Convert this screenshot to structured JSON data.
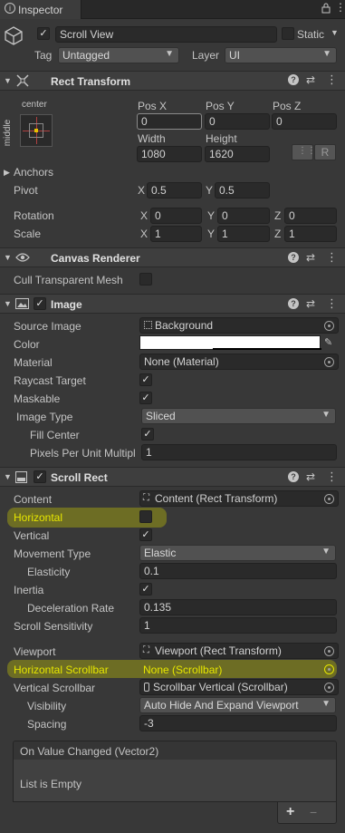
{
  "window": {
    "tab_title": "Inspector"
  },
  "gameobject": {
    "active": true,
    "name": "Scroll View",
    "static_label": "Static",
    "tag_label": "Tag",
    "tag_value": "Untagged",
    "layer_label": "Layer",
    "layer_value": "UI"
  },
  "rect_transform": {
    "title": "Rect Transform",
    "anchor_h": "center",
    "anchor_v": "middle",
    "posx_label": "Pos X",
    "posx": "0",
    "posy_label": "Pos Y",
    "posy": "0",
    "posz_label": "Pos Z",
    "posz": "0",
    "width_label": "Width",
    "width": "1080",
    "height_label": "Height",
    "height": "1620",
    "r_button": "R",
    "anchors_label": "Anchors",
    "pivot_label": "Pivot",
    "pivot_x": "0.5",
    "pivot_y": "0.5",
    "rotation_label": "Rotation",
    "rot_x": "0",
    "rot_y": "0",
    "rot_z": "0",
    "scale_label": "Scale",
    "scale_x": "1",
    "scale_y": "1",
    "scale_z": "1",
    "x": "X",
    "y": "Y",
    "z": "Z"
  },
  "canvas_renderer": {
    "title": "Canvas Renderer",
    "cull_label": "Cull Transparent Mesh",
    "cull": false
  },
  "image": {
    "title": "Image",
    "enabled": true,
    "source_label": "Source Image",
    "source_value": "Background",
    "color_label": "Color",
    "color_value": "#ffffff",
    "material_label": "Material",
    "material_value": "None (Material)",
    "raycast_label": "Raycast Target",
    "raycast": true,
    "maskable_label": "Maskable",
    "maskable": true,
    "image_type_label": "Image Type",
    "image_type_value": "Sliced",
    "fill_center_label": "Fill Center",
    "fill_center": true,
    "ppu_label": "Pixels Per Unit Multipl",
    "ppu_value": "1"
  },
  "scroll_rect": {
    "title": "Scroll Rect",
    "enabled": true,
    "content_label": "Content",
    "content_value": "Content (Rect Transform)",
    "horizontal_label": "Horizontal",
    "horizontal": false,
    "vertical_label": "Vertical",
    "vertical": true,
    "movement_label": "Movement Type",
    "movement_value": "Elastic",
    "elasticity_label": "Elasticity",
    "elasticity_value": "0.1",
    "inertia_label": "Inertia",
    "inertia": true,
    "decel_label": "Deceleration Rate",
    "decel_value": "0.135",
    "sensitivity_label": "Scroll Sensitivity",
    "sensitivity_value": "1",
    "viewport_label": "Viewport",
    "viewport_value": "Viewport (Rect Transform)",
    "hscroll_label": "Horizontal Scrollbar",
    "hscroll_value": "None (Scrollbar)",
    "vscroll_label": "Vertical Scrollbar",
    "vscroll_value": "Scrollbar Vertical (Scrollbar)",
    "visibility_label": "Visibility",
    "visibility_value": "Auto Hide And Expand Viewport",
    "spacing_label": "Spacing",
    "spacing_value": "-3",
    "event_title": "On Value Changed (Vector2)",
    "event_empty": "List is Empty",
    "add_button": "+",
    "remove_button": "−"
  },
  "colors": {
    "highlight": "#d2d200",
    "label_highlight": "#e6e600"
  }
}
